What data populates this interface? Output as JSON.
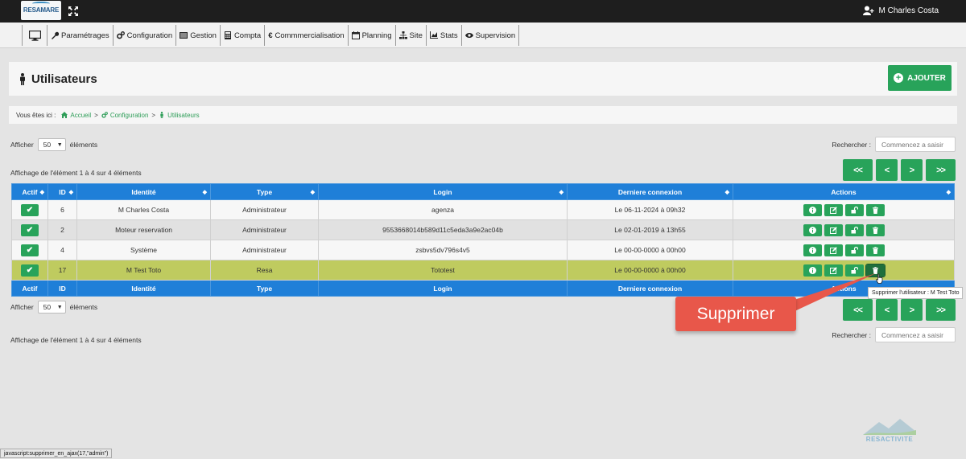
{
  "app": {
    "logo_text": "RESAMARE",
    "user_name": "M Charles Costa"
  },
  "nav": [
    {
      "label": "Paramétrages",
      "icon": "wrench-icon"
    },
    {
      "label": "Configuration",
      "icon": "gears-icon"
    },
    {
      "label": "Gestion",
      "icon": "list-icon"
    },
    {
      "label": "Compta",
      "icon": "calculator-icon"
    },
    {
      "label": "Commmercialisation",
      "icon": "euro-icon"
    },
    {
      "label": "Planning",
      "icon": "calendar-icon"
    },
    {
      "label": "Site",
      "icon": "sitemap-icon"
    },
    {
      "label": "Stats",
      "icon": "chart-icon"
    },
    {
      "label": "Supervision",
      "icon": "eye-icon"
    }
  ],
  "page": {
    "title": "Utilisateurs",
    "add_label": "AJOUTER"
  },
  "breadcrumb": {
    "prefix": "Vous êtes ici :",
    "items": [
      "Accueil",
      "Configuration",
      "Utilisateurs"
    ],
    "separator": ">"
  },
  "controls": {
    "show_label": "Afficher",
    "page_size": "50",
    "elements_label": "éléments",
    "search_label": "Rechercher :",
    "search_placeholder": "Commencez a saisir",
    "info": "Affichage de l'élément 1 à 4 sur 4 éléments"
  },
  "pager": {
    "first": "<<",
    "prev": "<",
    "next": ">",
    "last": ">>"
  },
  "table": {
    "columns": [
      "Actif",
      "ID",
      "Identité",
      "Type",
      "Login",
      "Derniere connexion",
      "Actions"
    ],
    "rows": [
      {
        "id": "6",
        "identity": "M Charles Costa",
        "type": "Administrateur",
        "login": "agenza",
        "last": "Le 06-11-2024 à 09h32"
      },
      {
        "id": "2",
        "identity": "Moteur reservation",
        "type": "Administrateur",
        "login": "9553668014b589d11c5eda3a9e2ac04b",
        "last": "Le 02-01-2019 à 13h55"
      },
      {
        "id": "4",
        "identity": "Système",
        "type": "Administrateur",
        "login": "zsbvs5dv796s4v5",
        "last": "Le 00-00-0000 à 00h00"
      },
      {
        "id": "17",
        "identity": "M Test Toto",
        "type": "Resa",
        "login": "Tototest",
        "last": "Le 00-00-0000 à 00h00"
      }
    ],
    "highlight_row": 3
  },
  "tooltip": "Supprimer l'utilisateur : M Test Toto",
  "annotation": "Supprimer",
  "status_bar": "javascript:supprimer_en_ajax(17,\"admin\")",
  "watermark": "RESACTIVITE",
  "colors": {
    "green": "#28a35a",
    "blue_header": "#1f7fd8",
    "highlight": "#bfcb5f",
    "callout": "#e8574a",
    "topbar": "#1e1e1e"
  }
}
